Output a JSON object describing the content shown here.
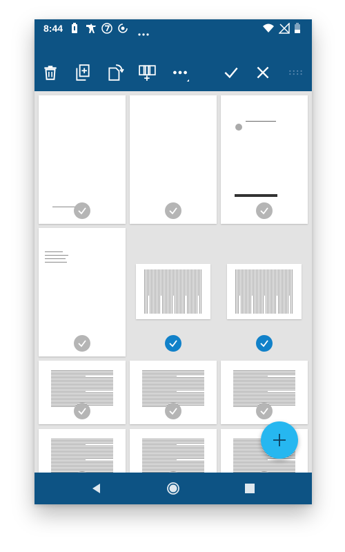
{
  "status_bar": {
    "time": "8:44",
    "icons": [
      "battery-saver-icon",
      "dog-notification-icon",
      "seven-badge-icon",
      "sync-icon",
      "more-dots-icon",
      "wifi-icon",
      "no-signal-icon",
      "battery-icon"
    ]
  },
  "toolbar": {
    "actions": [
      "delete",
      "add-page",
      "rotate",
      "merge",
      "more",
      "confirm",
      "cancel",
      "drag-handle"
    ]
  },
  "pages": [
    {
      "id": 1,
      "orientation": "portrait",
      "selected": false,
      "content": "title-footer"
    },
    {
      "id": 2,
      "orientation": "portrait",
      "selected": false,
      "content": "blank"
    },
    {
      "id": 3,
      "orientation": "portrait",
      "selected": false,
      "content": "cover"
    },
    {
      "id": 4,
      "orientation": "portrait",
      "selected": false,
      "content": "contents"
    },
    {
      "id": 5,
      "orientation": "landscape",
      "selected": true,
      "content": "text"
    },
    {
      "id": 6,
      "orientation": "landscape",
      "selected": true,
      "content": "text"
    },
    {
      "id": 7,
      "orientation": "portrait",
      "selected": false,
      "content": "text"
    },
    {
      "id": 8,
      "orientation": "portrait",
      "selected": false,
      "content": "text"
    },
    {
      "id": 9,
      "orientation": "portrait",
      "selected": false,
      "content": "text"
    },
    {
      "id": 10,
      "orientation": "portrait",
      "selected": false,
      "content": "text"
    },
    {
      "id": 11,
      "orientation": "portrait",
      "selected": false,
      "content": "text"
    },
    {
      "id": 12,
      "orientation": "portrait",
      "selected": false,
      "content": "text"
    }
  ],
  "colors": {
    "brand": "#0d5384",
    "fab": "#26b7f0",
    "selected": "#1181c9",
    "unselected": "#b5b5b5",
    "grid_background": "#e3e3e3"
  },
  "fab": {
    "icon": "plus-icon"
  },
  "nav_bar": {
    "buttons": [
      "back",
      "home",
      "recents"
    ]
  }
}
